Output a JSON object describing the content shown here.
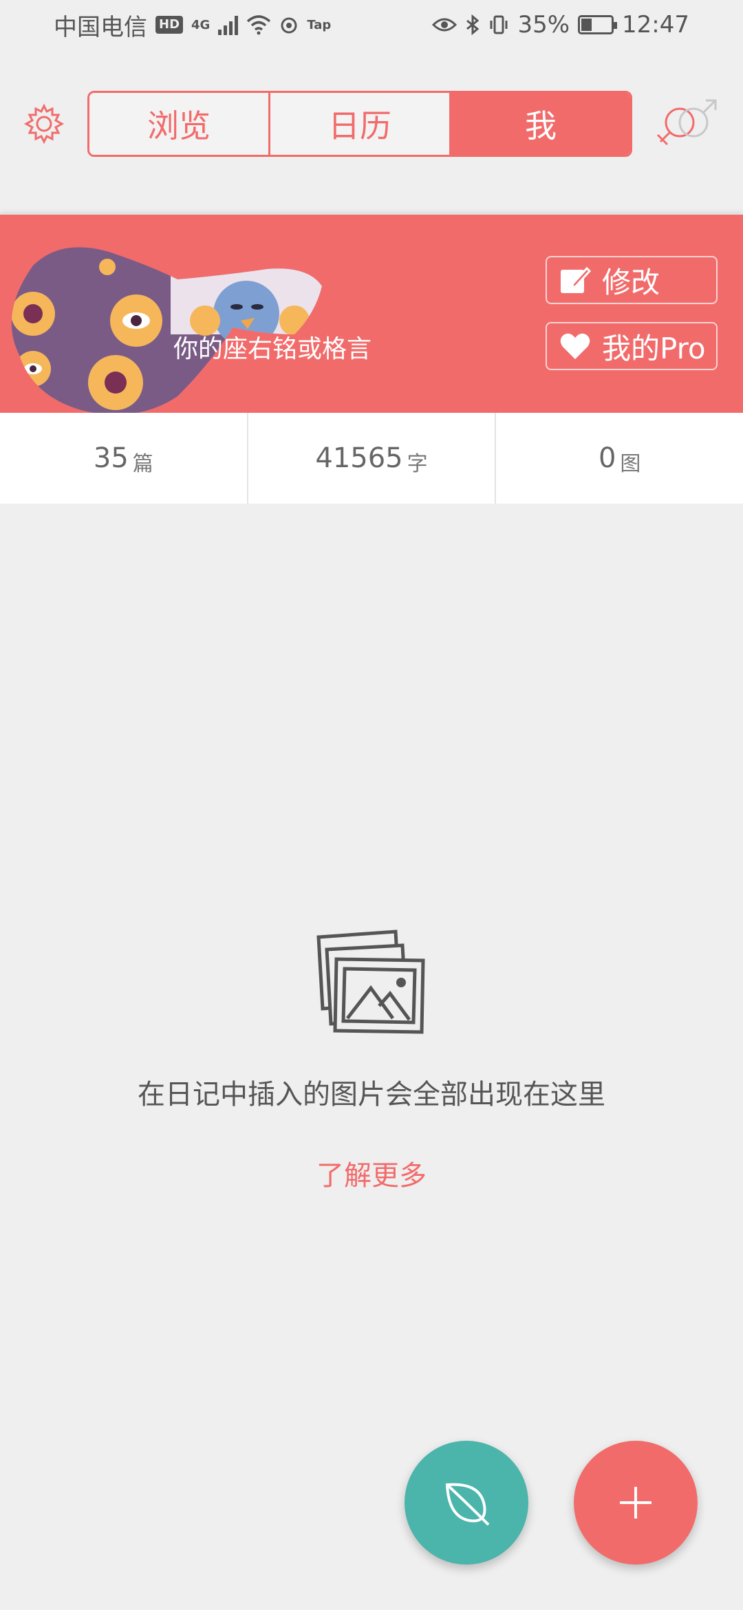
{
  "status_bar": {
    "carrier": "中国电信",
    "hd": "HD",
    "network": "4G",
    "extra": "Tap",
    "battery_percent": "35%",
    "battery_level": 0.35,
    "time": "12:47"
  },
  "nav": {
    "tabs": [
      {
        "label": "浏览"
      },
      {
        "label": "日历"
      },
      {
        "label": "我"
      }
    ],
    "active_tab": "我",
    "accent_color": "#f26b6b"
  },
  "profile": {
    "motto": "你的座右铭或格言",
    "edit_label": "修改",
    "pro_label": "我的Pro"
  },
  "stats": [
    {
      "value": "35",
      "unit": "篇"
    },
    {
      "value": "41565",
      "unit": "字"
    },
    {
      "value": "0",
      "unit": "图"
    }
  ],
  "empty_state": {
    "icon": "photo-stack-icon",
    "message": "在日记中插入的图片会全部出现在这里",
    "link": "了解更多"
  },
  "fabs": [
    {
      "icon": "leaf-icon",
      "color": "#4bb4ab"
    },
    {
      "icon": "plus-icon",
      "color": "#f26b6b"
    }
  ]
}
